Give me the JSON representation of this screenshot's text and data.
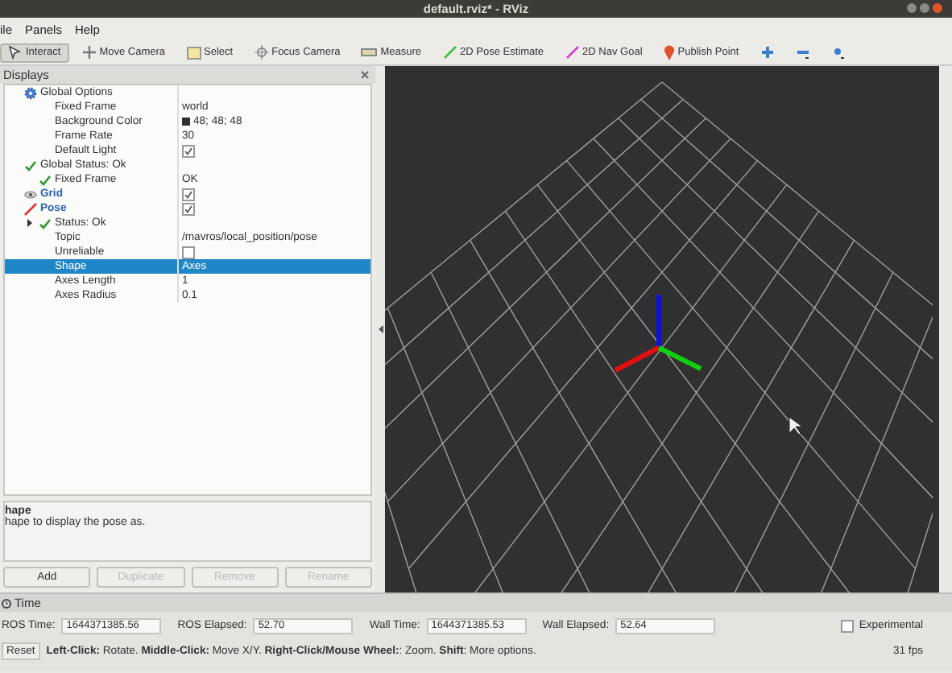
{
  "window": {
    "title": "default.rviz* - RViz"
  },
  "menu": [
    "ile",
    "Panels",
    "Help"
  ],
  "toolbar": [
    {
      "label": "Interact",
      "kind": "interact",
      "selected": true
    },
    {
      "label": "Move Camera",
      "kind": "move",
      "selected": false
    },
    {
      "label": "Select",
      "kind": "select",
      "selected": false
    },
    {
      "label": "Focus Camera",
      "kind": "focus",
      "selected": false
    },
    {
      "label": "Measure",
      "kind": "measure",
      "selected": false
    },
    {
      "label": "2D Pose Estimate",
      "kind": "pose",
      "selected": false
    },
    {
      "label": "2D Nav Goal",
      "kind": "goal",
      "selected": false
    },
    {
      "label": "Publish Point",
      "kind": "point",
      "selected": false
    },
    {
      "kind": "plus",
      "selected": false
    },
    {
      "kind": "minus",
      "selected": false
    },
    {
      "kind": "dot",
      "selected": false
    }
  ],
  "displays_panel": {
    "title": "Displays",
    "rows": [
      {
        "label": "Global Options",
        "kind": "options",
        "children": [
          {
            "label": "Fixed Frame",
            "value": "world"
          },
          {
            "label": "Background Color",
            "value": "48; 48; 48",
            "color": "#303030"
          },
          {
            "label": "Frame Rate",
            "value": "30"
          },
          {
            "label": "Default Light",
            "checked": true
          }
        ]
      },
      {
        "label": "Global Status: Ok",
        "kind": "status",
        "children": [
          {
            "label": "Fixed Frame",
            "kind": "status",
            "value": "OK"
          }
        ]
      },
      {
        "label": "Grid",
        "kind": "grid",
        "checked": true
      },
      {
        "label": "Pose",
        "kind": "pose",
        "checked": true,
        "children": [
          {
            "label": "Status: Ok",
            "kind": "status",
            "expanded": false
          },
          {
            "label": "Topic",
            "value": "/mavros/local_position/pose"
          },
          {
            "label": "Unreliable",
            "checked": false
          },
          {
            "label": "Shape",
            "value": "Axes",
            "selected": true
          },
          {
            "label": "Axes Length",
            "value": "1"
          },
          {
            "label": "Axes Radius",
            "value": "0.1"
          }
        ]
      }
    ],
    "description": {
      "title": "hape",
      "text": "hape to display the pose as."
    },
    "buttons": [
      {
        "label": "Add",
        "disabled": false
      },
      {
        "label": "Duplicate",
        "disabled": true
      },
      {
        "label": "Remove",
        "disabled": true
      },
      {
        "label": "Rename",
        "disabled": true
      }
    ]
  },
  "time_panel": {
    "title": "Time",
    "fields": [
      {
        "label": "ROS Time:",
        "value": "1644371385.56"
      },
      {
        "label": "ROS Elapsed:",
        "value": "52.70"
      },
      {
        "label": "Wall Time:",
        "value": "1644371385.53"
      },
      {
        "label": "Wall Elapsed:",
        "value": "52.64"
      }
    ],
    "experimental": {
      "label": "Experimental",
      "checked": false
    },
    "reset": "Reset",
    "hint": "**Left-Click:** Rotate. **Middle-Click:** Move X/Y. **Right-Click/Mouse Wheel:**: Zoom. **Shift**: More options.",
    "fps": "31 fps"
  }
}
